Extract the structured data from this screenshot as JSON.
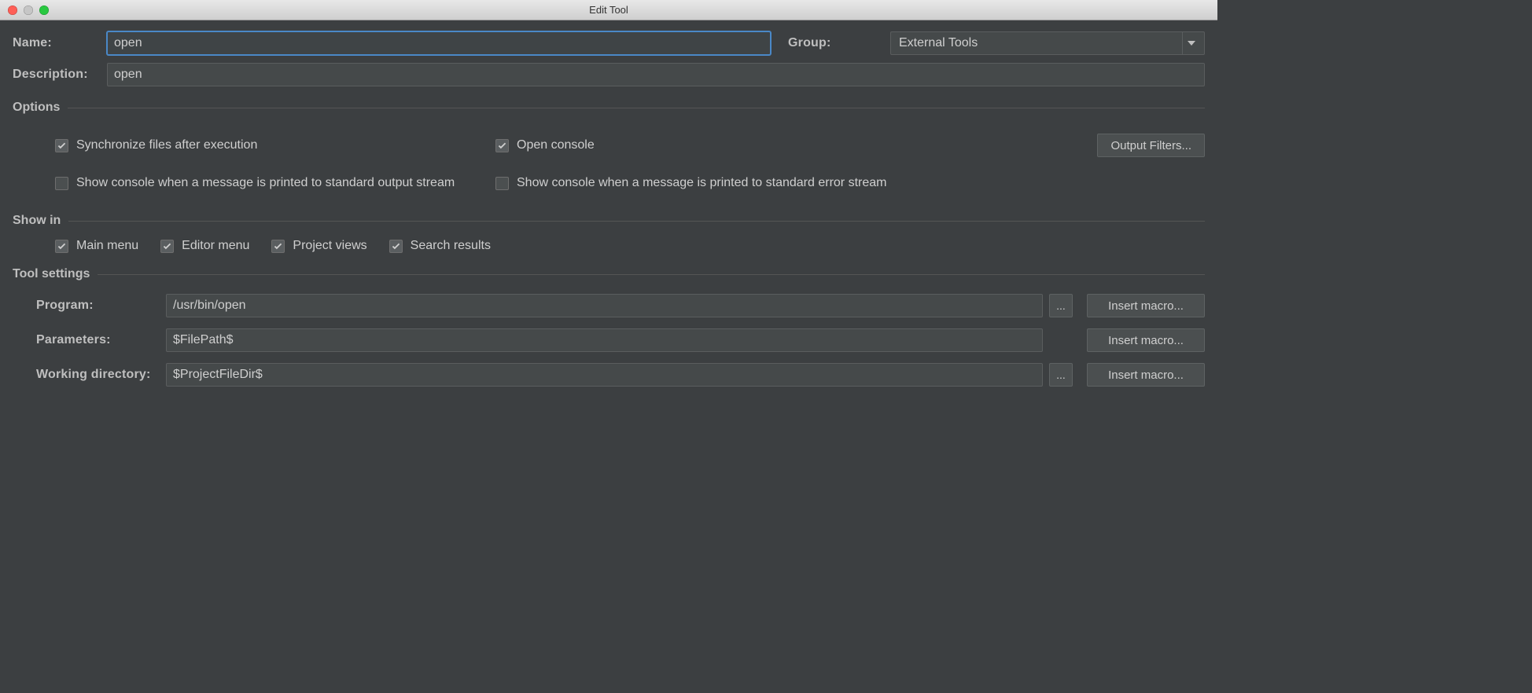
{
  "window": {
    "title": "Edit Tool"
  },
  "labels": {
    "name": "Name:",
    "group": "Group:",
    "description": "Description:",
    "options": "Options",
    "show_in": "Show in",
    "tool_settings": "Tool settings",
    "program": "Program:",
    "parameters": "Parameters:",
    "working_dir": "Working directory:"
  },
  "values": {
    "name": "open",
    "group_selected": "External Tools",
    "description": "open",
    "program": "/usr/bin/open",
    "parameters": "$FilePath$",
    "working_dir": "$ProjectFileDir$"
  },
  "options": {
    "sync_files": {
      "label": "Synchronize files after execution",
      "checked": true
    },
    "open_console": {
      "label": "Open console",
      "checked": true
    },
    "stdout": {
      "label": "Show console when a message is printed to standard output stream",
      "checked": false
    },
    "stderr": {
      "label": "Show console when a message is printed to standard error stream",
      "checked": false
    }
  },
  "show_in": {
    "main_menu": {
      "label": "Main menu",
      "checked": true
    },
    "editor_menu": {
      "label": "Editor menu",
      "checked": true
    },
    "project_views": {
      "label": "Project views",
      "checked": true
    },
    "search_results": {
      "label": "Search results",
      "checked": true
    }
  },
  "buttons": {
    "output_filters": "Output Filters...",
    "insert_macro": "Insert macro...",
    "browse": "..."
  }
}
